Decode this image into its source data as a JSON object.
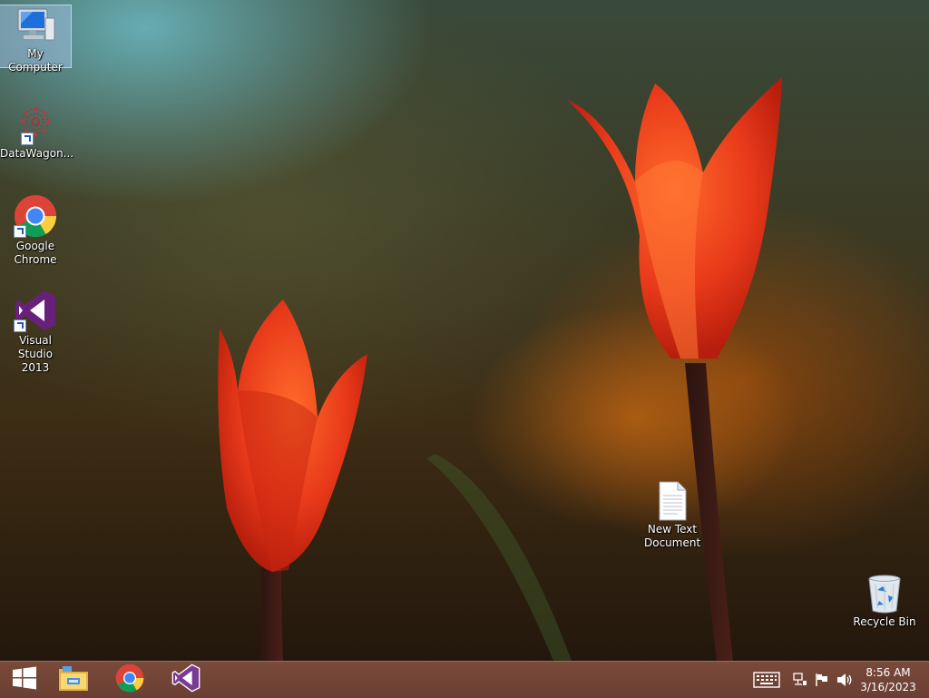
{
  "desktop": {
    "icons": [
      {
        "label": "My Computer",
        "icon": "my-computer-icon"
      },
      {
        "label": "DataWagon...",
        "icon": "datawagon-icon"
      },
      {
        "label": "Google Chrome",
        "icon": "chrome-icon"
      },
      {
        "label": "Visual Studio 2013",
        "icon": "visual-studio-icon"
      },
      {
        "label": "New Text Document",
        "icon": "text-document-icon"
      },
      {
        "label": "Recycle Bin",
        "icon": "recycle-bin-icon"
      }
    ]
  },
  "taskbar": {
    "pinned": [
      {
        "icon": "windows-start-icon"
      },
      {
        "icon": "file-explorer-icon"
      },
      {
        "icon": "chrome-icon"
      },
      {
        "icon": "visual-studio-icon"
      }
    ],
    "tray": {
      "icons": [
        "keyboard-icon",
        "network-icon",
        "action-center-flag-icon",
        "volume-icon"
      ],
      "time": "8:56 AM",
      "date": "3/16/2023"
    }
  },
  "colors": {
    "taskbar": "#6a3f33",
    "tulip": "#e8391a",
    "visual_studio": "#68217a"
  }
}
